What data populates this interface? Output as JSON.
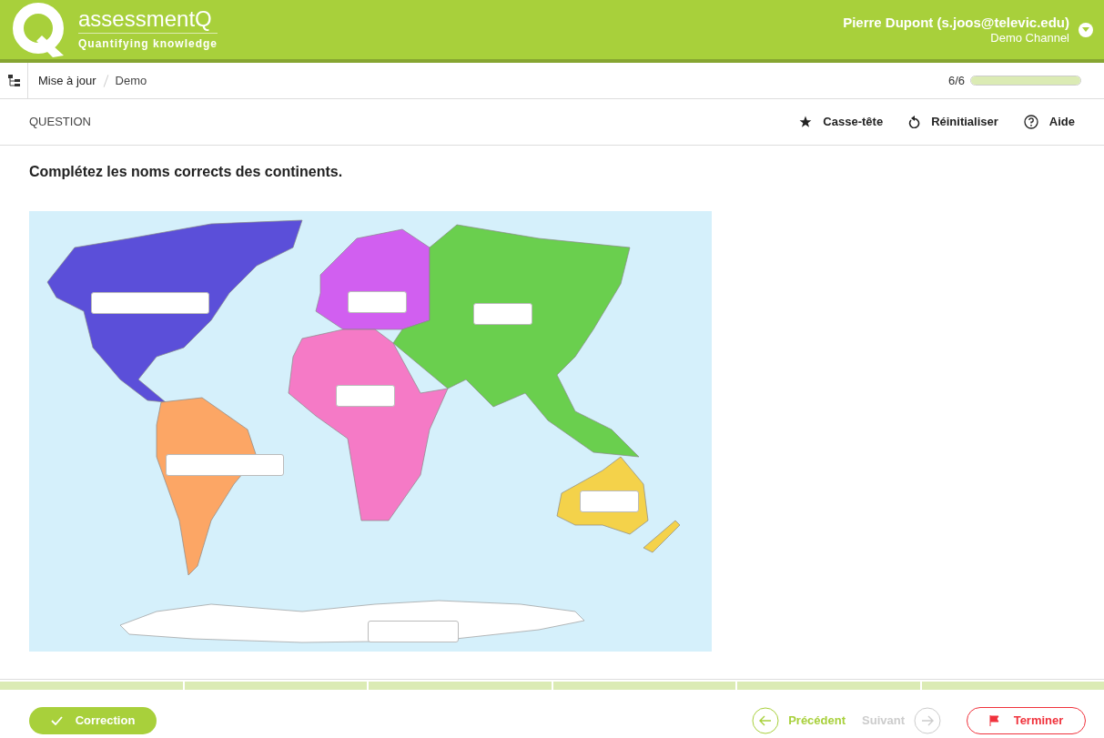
{
  "header": {
    "brand": "assessmentQ",
    "tagline": "Quantifying knowledge",
    "user": "Pierre Dupont (s.joos@televic.edu)",
    "channel": "Demo Channel"
  },
  "breadcrumb": [
    "Mise à jour",
    "Demo"
  ],
  "progress": {
    "label": "6/6",
    "level": 1.0
  },
  "toolbar": {
    "section": "QUESTION",
    "actions": [
      {
        "kind": "star",
        "label": "Casse-tête"
      },
      {
        "kind": "reset",
        "label": "Réinitialiser"
      },
      {
        "kind": "help",
        "label": "Aide"
      }
    ]
  },
  "question": {
    "prompt": "Complétez les noms corrects des continents."
  },
  "footer": {
    "correction": "Correction",
    "previous": {
      "label": "Précédent",
      "disabled": false
    },
    "next": {
      "label": "Suivant",
      "disabled": true
    },
    "finish": "Terminer"
  }
}
